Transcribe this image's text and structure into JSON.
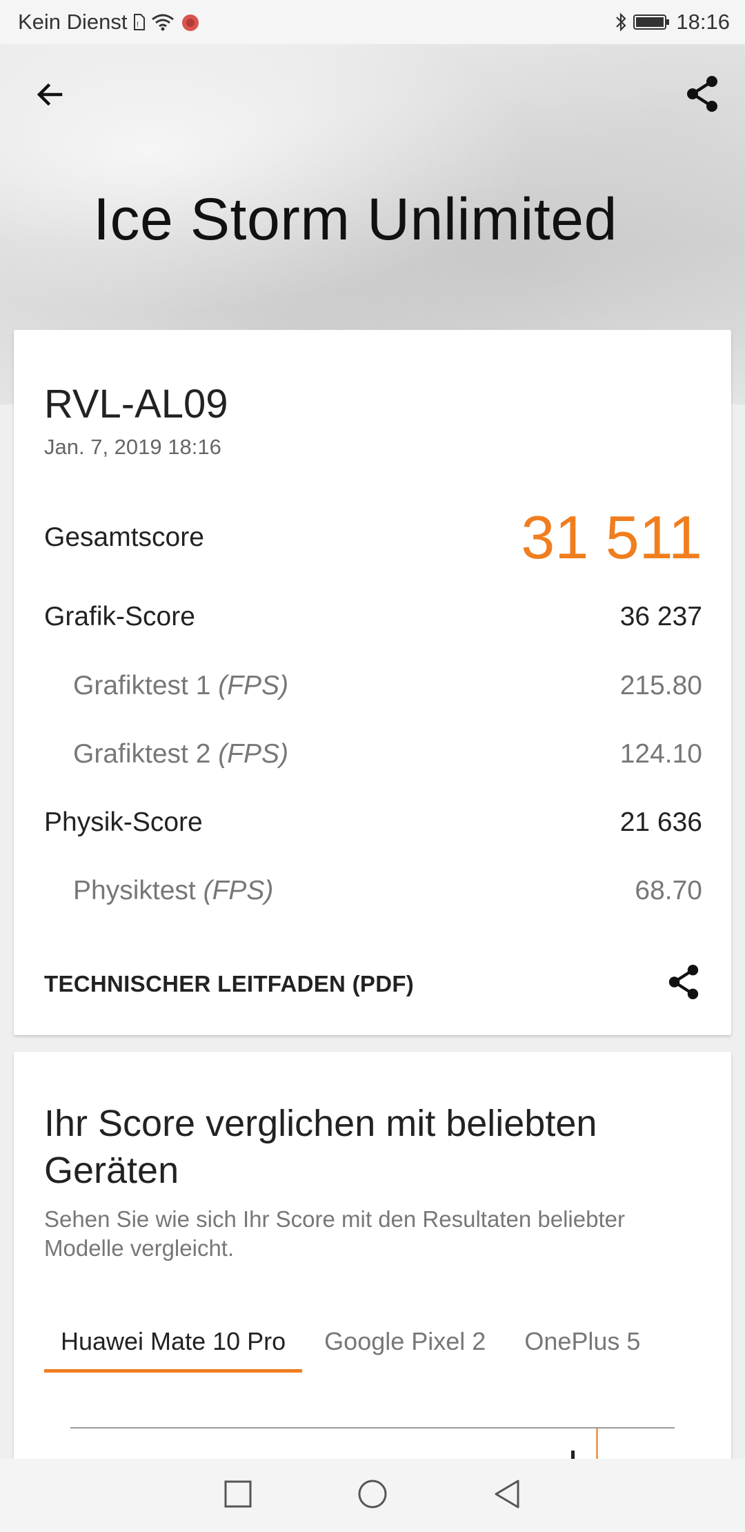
{
  "status_bar": {
    "carrier": "Kein Dienst",
    "time": "18:16",
    "icons": [
      "sim-icon",
      "wifi-icon",
      "app-notification-icon",
      "bluetooth-icon",
      "battery-icon"
    ]
  },
  "header": {
    "title": "Ice Storm Unlimited",
    "back_icon": "arrow-left-icon",
    "share_icon": "share-icon"
  },
  "result": {
    "device": "RVL-AL09",
    "date": "Jan. 7, 2019 18:16",
    "total_label": "Gesamtscore",
    "total_value": "31 511",
    "rows": [
      {
        "label": "Grafik-Score",
        "unit": "",
        "value": "36 237",
        "sub": false
      },
      {
        "label": "Grafiktest 1 ",
        "unit": "(FPS)",
        "value": "215.80",
        "sub": true
      },
      {
        "label": "Grafiktest 2 ",
        "unit": "(FPS)",
        "value": "124.10",
        "sub": true
      },
      {
        "label": "Physik-Score",
        "unit": "",
        "value": "21 636",
        "sub": false
      },
      {
        "label": "Physiktest ",
        "unit": "(FPS)",
        "value": "68.70",
        "sub": true
      }
    ],
    "pdf_label": "TECHNISCHER LEITFADEN (PDF)"
  },
  "comparison": {
    "title": "Ihr Score verglichen mit beliebten Geräten",
    "subtitle": "Sehen Sie wie sich Ihr Score mit den Resultaten beliebter Modelle vergleicht.",
    "tabs": [
      "Huawei Mate 10 Pro",
      "Google Pixel 2",
      "OnePlus 5"
    ],
    "active_tab": 0
  },
  "colors": {
    "accent": "#f07e1f",
    "text": "#222222",
    "muted": "#777777"
  },
  "nav_bar": {
    "icons": [
      "recents-square-icon",
      "home-circle-icon",
      "back-triangle-icon"
    ]
  }
}
